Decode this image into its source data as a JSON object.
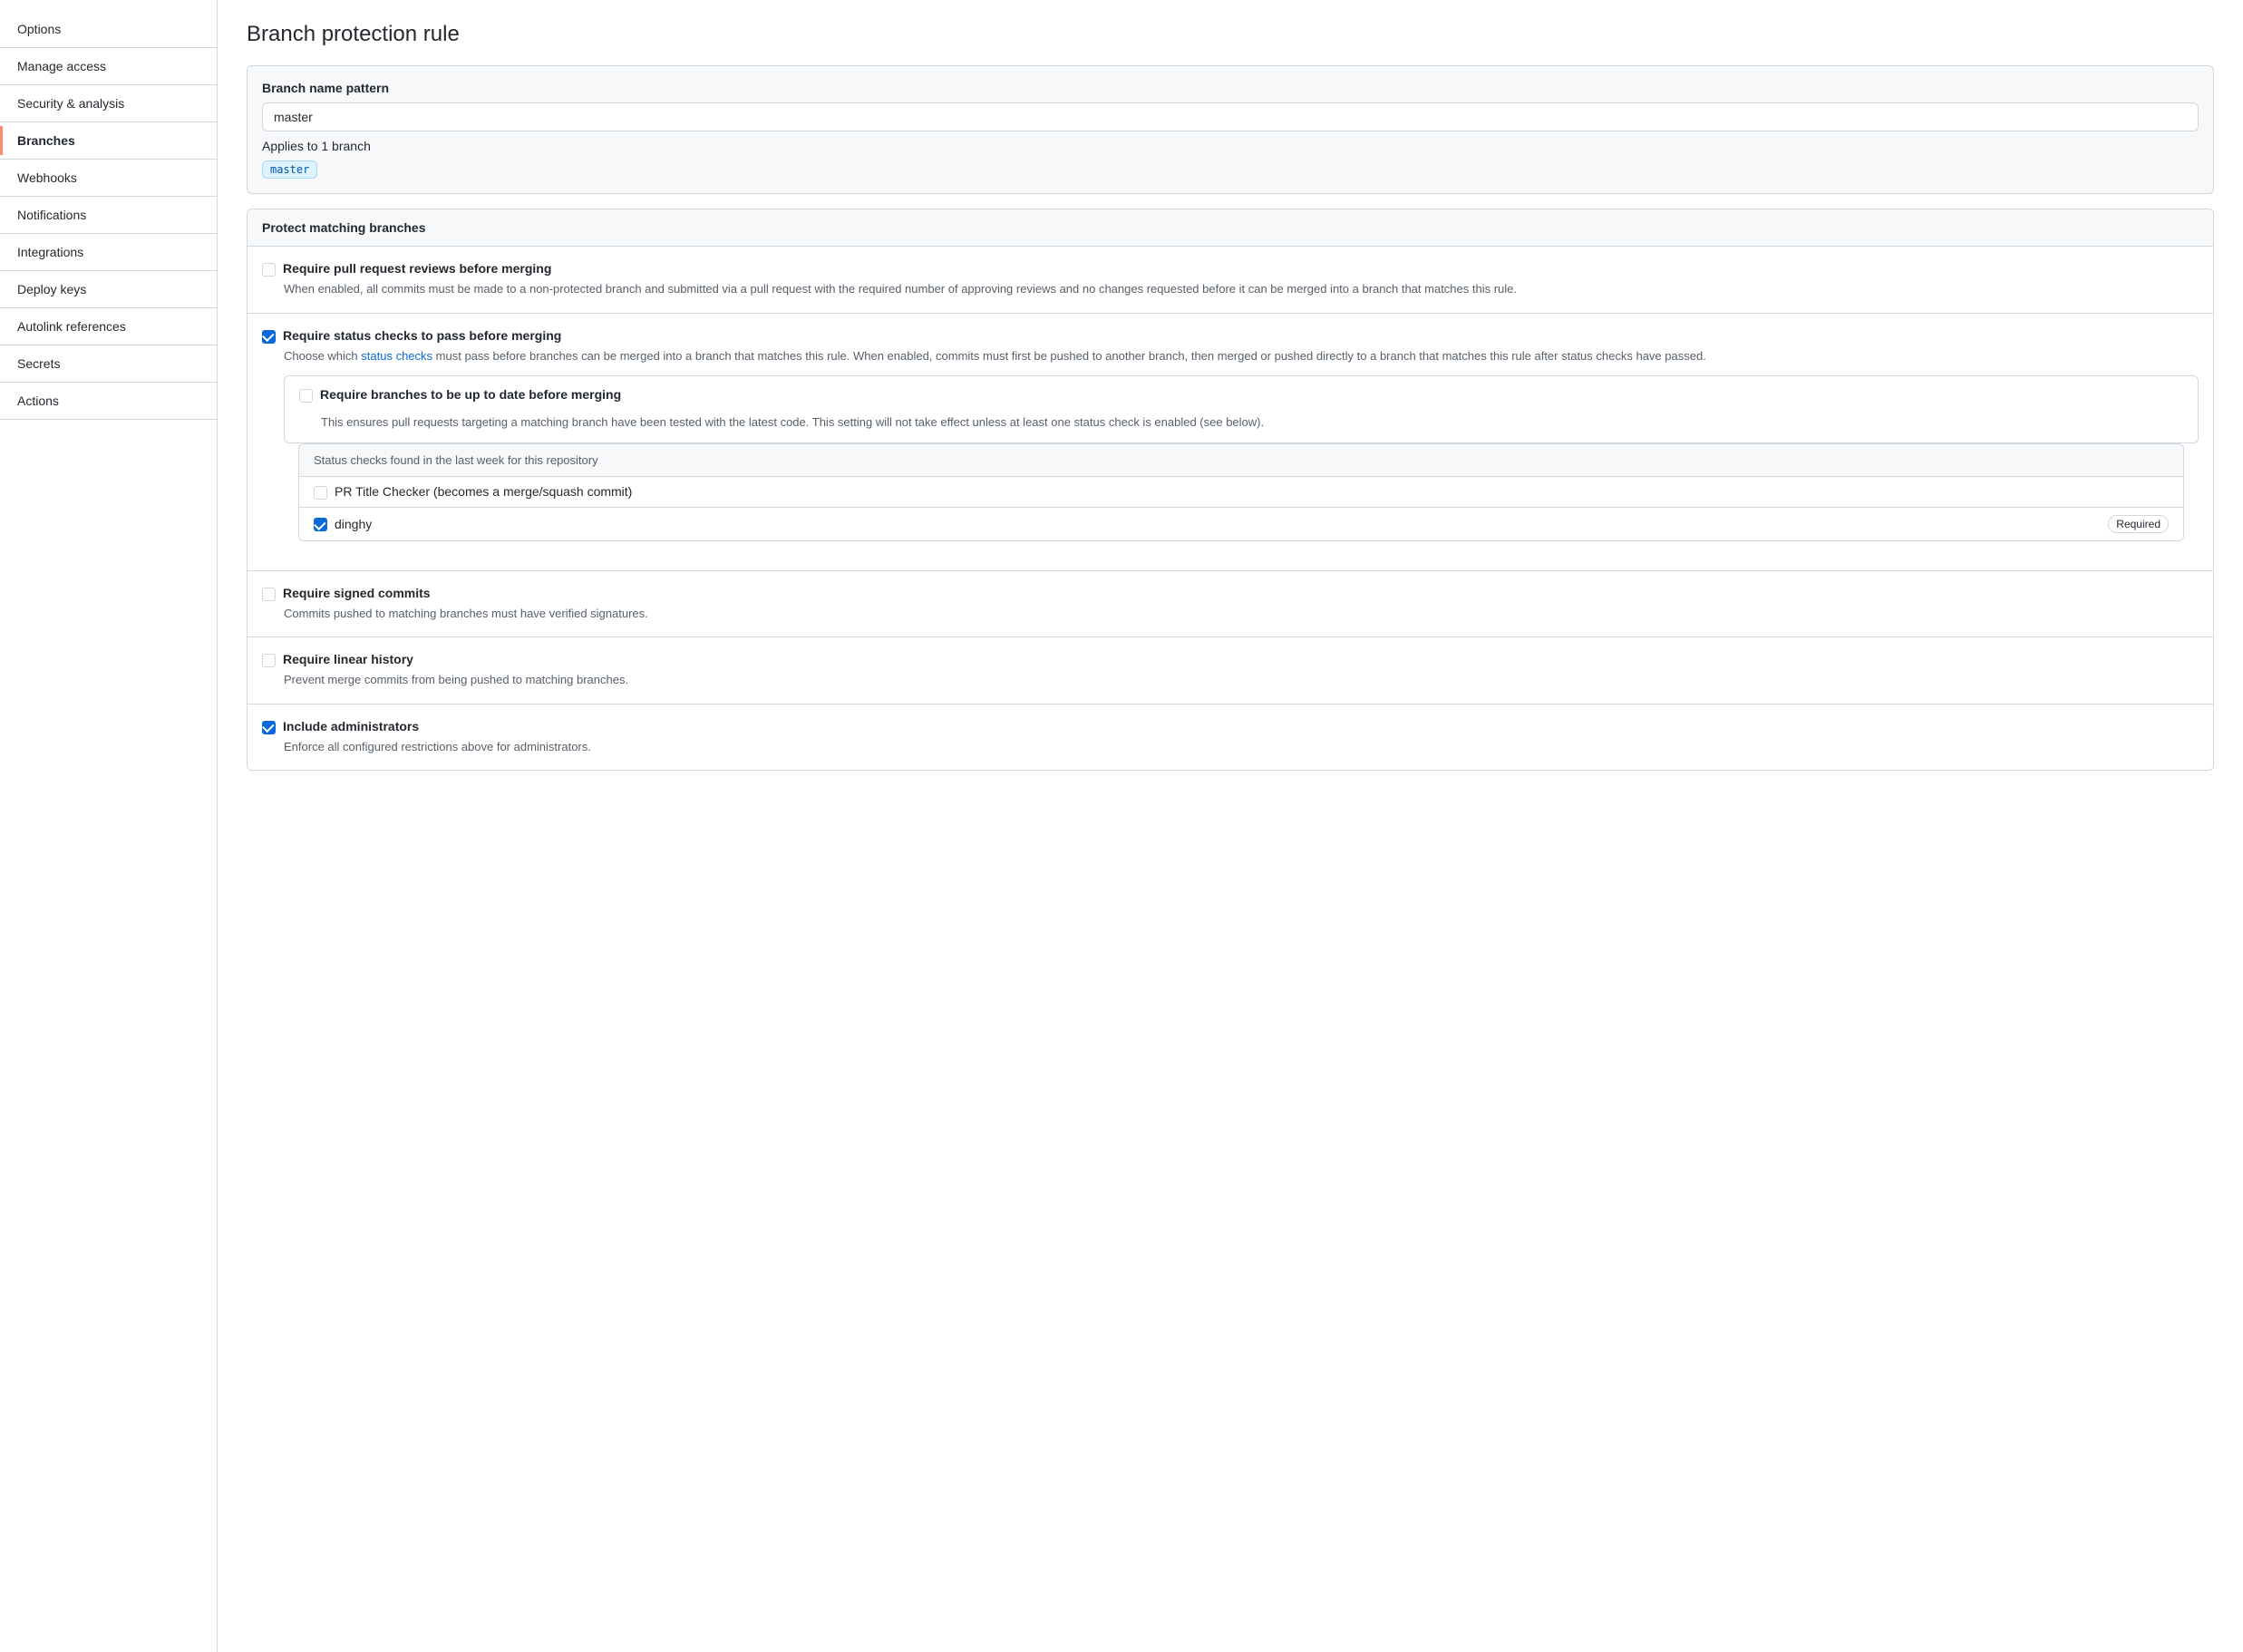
{
  "sidebar": {
    "items": [
      {
        "id": "options",
        "label": "Options",
        "active": false
      },
      {
        "id": "manage-access",
        "label": "Manage access",
        "active": false
      },
      {
        "id": "security-analysis",
        "label": "Security & analysis",
        "active": false
      },
      {
        "id": "branches",
        "label": "Branches",
        "active": true
      },
      {
        "id": "webhooks",
        "label": "Webhooks",
        "active": false
      },
      {
        "id": "notifications",
        "label": "Notifications",
        "active": false
      },
      {
        "id": "integrations",
        "label": "Integrations",
        "active": false
      },
      {
        "id": "deploy-keys",
        "label": "Deploy keys",
        "active": false
      },
      {
        "id": "autolink-references",
        "label": "Autolink references",
        "active": false
      },
      {
        "id": "secrets",
        "label": "Secrets",
        "active": false
      },
      {
        "id": "actions",
        "label": "Actions",
        "active": false
      }
    ]
  },
  "page": {
    "title": "Branch protection rule",
    "branch_pattern_label": "Branch name pattern",
    "branch_pattern_value": "master",
    "applies_text": "Applies to 1 branch",
    "branch_tag": "master",
    "protect_section_title": "Protect matching branches",
    "rules": [
      {
        "id": "pr-reviews",
        "label": "Require pull request reviews before merging",
        "checked": false,
        "description": "When enabled, all commits must be made to a non-protected branch and submitted via a pull request with the required number of approving reviews and no changes requested before it can be merged into a branch that matches this rule."
      },
      {
        "id": "status-checks",
        "label": "Require status checks to pass before merging",
        "checked": true,
        "description_prefix": "Choose which ",
        "description_link": "status checks",
        "description_suffix": " must pass before branches can be merged into a branch that matches this rule. When enabled, commits must first be pushed to another branch, then merged or pushed directly to a branch that matches this rule after status checks have passed.",
        "nested": {
          "id": "up-to-date",
          "label": "Require branches to be up to date before merging",
          "checked": false,
          "description": "This ensures pull requests targeting a matching branch have been tested with the latest code. This setting will not take effect unless at least one status check is enabled (see below)."
        },
        "status_checks_header": "Status checks found in the last week for this repository",
        "status_checks": [
          {
            "id": "pr-title-checker",
            "label": "PR Title Checker (becomes a merge/squash commit)",
            "checked": false,
            "required": false
          },
          {
            "id": "dinghy",
            "label": "dinghy",
            "checked": true,
            "required": true,
            "required_label": "Required"
          }
        ]
      },
      {
        "id": "signed-commits",
        "label": "Require signed commits",
        "checked": false,
        "description": "Commits pushed to matching branches must have verified signatures."
      },
      {
        "id": "linear-history",
        "label": "Require linear history",
        "checked": false,
        "description": "Prevent merge commits from being pushed to matching branches."
      },
      {
        "id": "include-admins",
        "label": "Include administrators",
        "checked": true,
        "description": "Enforce all configured restrictions above for administrators."
      }
    ]
  }
}
